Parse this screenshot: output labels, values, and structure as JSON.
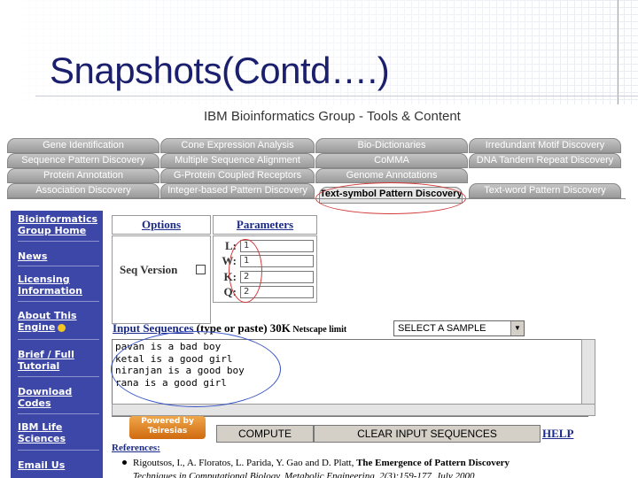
{
  "slide": {
    "title": "Snapshots(Contd….)"
  },
  "page_header": "IBM Bioinformatics Group - Tools & Content",
  "tabs": [
    "Gene Identification",
    "Cone Expression Analysis",
    "Bio-Dictionaries",
    "Irredundant Motif Discovery",
    "Sequence Pattern Discovery",
    "Multiple Sequence Alignment",
    "CoMMA",
    "DNA Tandem Repeat Discovery",
    "Protein Annotation",
    "G-Protein Coupled Receptors",
    "Genome Annotations",
    "Association Discovery",
    "Integer-based Pattern Discovery",
    "Text-symbol Pattern Discovery",
    "Text-word Pattern Discovery"
  ],
  "sidebar": {
    "items": [
      "Bioinformatics Group Home",
      "News",
      "Licensing Information",
      "About This Engine",
      "Brief / Full Tutorial",
      "Download Codes",
      "IBM Life Sciences",
      "Email Us"
    ]
  },
  "form": {
    "options_header": "Options",
    "parameters_header": "Parameters",
    "seq_version_label": "Seq Version",
    "params": [
      {
        "label": "L:",
        "value": "1"
      },
      {
        "label": "W:",
        "value": "1"
      },
      {
        "label": "K:",
        "value": "2"
      },
      {
        "label": "Q:",
        "value": "2"
      }
    ],
    "input_label_link": "Input Sequences",
    "input_label_rest": " (type or paste) 30K",
    "input_label_small": " Netscape limit",
    "sample_select": "SELECT A SAMPLE",
    "sequences": "pavan is a bad boy\nketal is a good girl\nniranjan is a good boy\nrana is a good girl"
  },
  "powered_by": "Powered by Teiresias",
  "buttons": {
    "compute": "COMPUTE",
    "clear": "CLEAR INPUT SEQUENCES",
    "help": "HELP"
  },
  "references": {
    "label": "References:",
    "authors": "Rigoutsos, I., A. Floratos, L. Parida, Y. Gao and D. Platt,",
    "title": "The Emergence of Pattern Discovery",
    "line2": "Techniques in Computational Biology, Metabolic Engineering, 2(3):159-177, July 2000"
  },
  "colors": {
    "title": "#1a1f6e",
    "sidebar": "#3c47a8",
    "link": "#1a2a8a",
    "highlight_red": "#d23a3a",
    "highlight_blue": "#3a55c8"
  }
}
